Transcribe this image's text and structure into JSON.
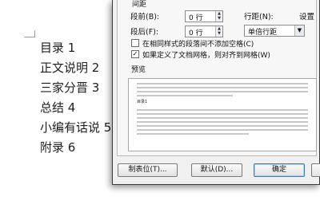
{
  "document": {
    "toc": [
      "目录 1",
      "正文说明 2",
      "三家分晋 3",
      "总结 4",
      "小编有话说 5",
      "附录 6"
    ]
  },
  "dialog": {
    "section_title": "间距",
    "before": {
      "label": "段前(B):",
      "value": "0 行"
    },
    "after": {
      "label": "段后(F):",
      "value": "0 行"
    },
    "line_spacing": {
      "label": "行距(N):",
      "value": "单倍行距"
    },
    "set_value_label": "设置",
    "no_space_same_style": {
      "label": "在相同样式的段落间不添加空格(C)",
      "checked": false
    },
    "snap_to_grid": {
      "label": "如果定义了文档网格，则对齐到网格(W)",
      "checked": true
    },
    "preview": {
      "label": "预览",
      "sample_text": "目录1"
    },
    "buttons": {
      "tabs": "制表位(T)...",
      "default": "默认(D)...",
      "ok": "确定",
      "cancel": ""
    }
  }
}
